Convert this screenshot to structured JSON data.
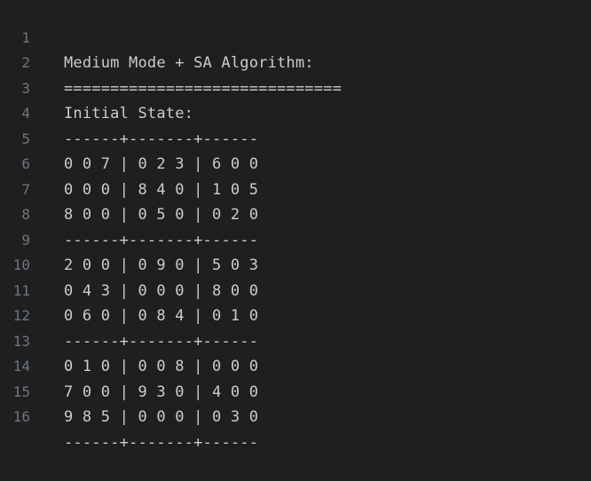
{
  "editor": {
    "lines": [
      {
        "num": "1",
        "text": "Medium Mode + SA Algorithm:"
      },
      {
        "num": "2",
        "text": "=============================="
      },
      {
        "num": "3",
        "text": "Initial State:"
      },
      {
        "num": "4",
        "text": "------+-------+------"
      },
      {
        "num": "5",
        "text": "0 0 7 | 0 2 3 | 6 0 0"
      },
      {
        "num": "6",
        "text": "0 0 0 | 8 4 0 | 1 0 5"
      },
      {
        "num": "7",
        "text": "8 0 0 | 0 5 0 | 0 2 0"
      },
      {
        "num": "8",
        "text": "------+-------+------"
      },
      {
        "num": "9",
        "text": "2 0 0 | 0 9 0 | 5 0 3"
      },
      {
        "num": "10",
        "text": "0 4 3 | 0 0 0 | 8 0 0"
      },
      {
        "num": "11",
        "text": "0 6 0 | 0 8 4 | 0 1 0"
      },
      {
        "num": "12",
        "text": "------+-------+------"
      },
      {
        "num": "13",
        "text": "0 1 0 | 0 0 8 | 0 0 0"
      },
      {
        "num": "14",
        "text": "7 0 0 | 9 3 0 | 4 0 0"
      },
      {
        "num": "15",
        "text": "9 8 5 | 0 0 0 | 0 3 0"
      },
      {
        "num": "16",
        "text": "------+-------+------"
      }
    ]
  }
}
